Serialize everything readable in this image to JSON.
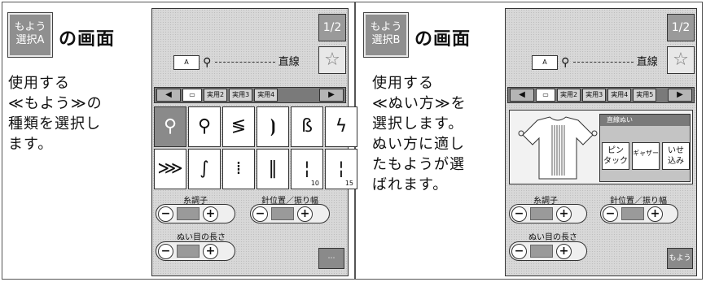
{
  "left": {
    "badge_label": "もよう\n選択A",
    "heading": "の画面",
    "description": "使用する\n≪もよう≫の\n種類を選択し\nます。",
    "screen": {
      "mode_text": "直線",
      "top_button": "1/2",
      "tabs": [
        "実用2",
        "実用3",
        "実用4"
      ],
      "stitch_cells": [
        {
          "glyph": "⚲",
          "num": ""
        },
        {
          "glyph": "⚲",
          "num": ""
        },
        {
          "glyph": "≶",
          "num": ""
        },
        {
          "glyph": "⦘",
          "num": ""
        },
        {
          "glyph": "ß",
          "num": ""
        },
        {
          "glyph": "ϟ",
          "num": ""
        },
        {
          "glyph": "⋙",
          "num": ""
        },
        {
          "glyph": "∫",
          "num": ""
        },
        {
          "glyph": "⁞",
          "num": ""
        },
        {
          "glyph": "‖",
          "num": ""
        },
        {
          "glyph": "¦",
          "num": "10"
        },
        {
          "glyph": "¦",
          "num": "15"
        }
      ],
      "label_tension": "糸調子",
      "label_position": "針位置／振り幅",
      "label_length": "ぬい目の長さ"
    }
  },
  "right": {
    "badge_label": "もよう\n選択B",
    "heading": "の画面",
    "description": "使用する\n≪ぬい方≫を\n選択します。\nぬい方に適し\nたもようが選\nばれます。",
    "screen": {
      "mode_text": "直線",
      "top_button": "1/2",
      "tabs": [
        "実用2",
        "実用3",
        "実用4",
        "実用5"
      ],
      "popup_title": "直線ぬい",
      "methods": [
        "ピン\nタック",
        "ギャザー",
        "いせ\n込み"
      ],
      "label_tension": "糸調子",
      "label_position": "針位置／振り幅",
      "label_length": "ぬい目の長さ",
      "moyou_button": "もよう"
    }
  }
}
